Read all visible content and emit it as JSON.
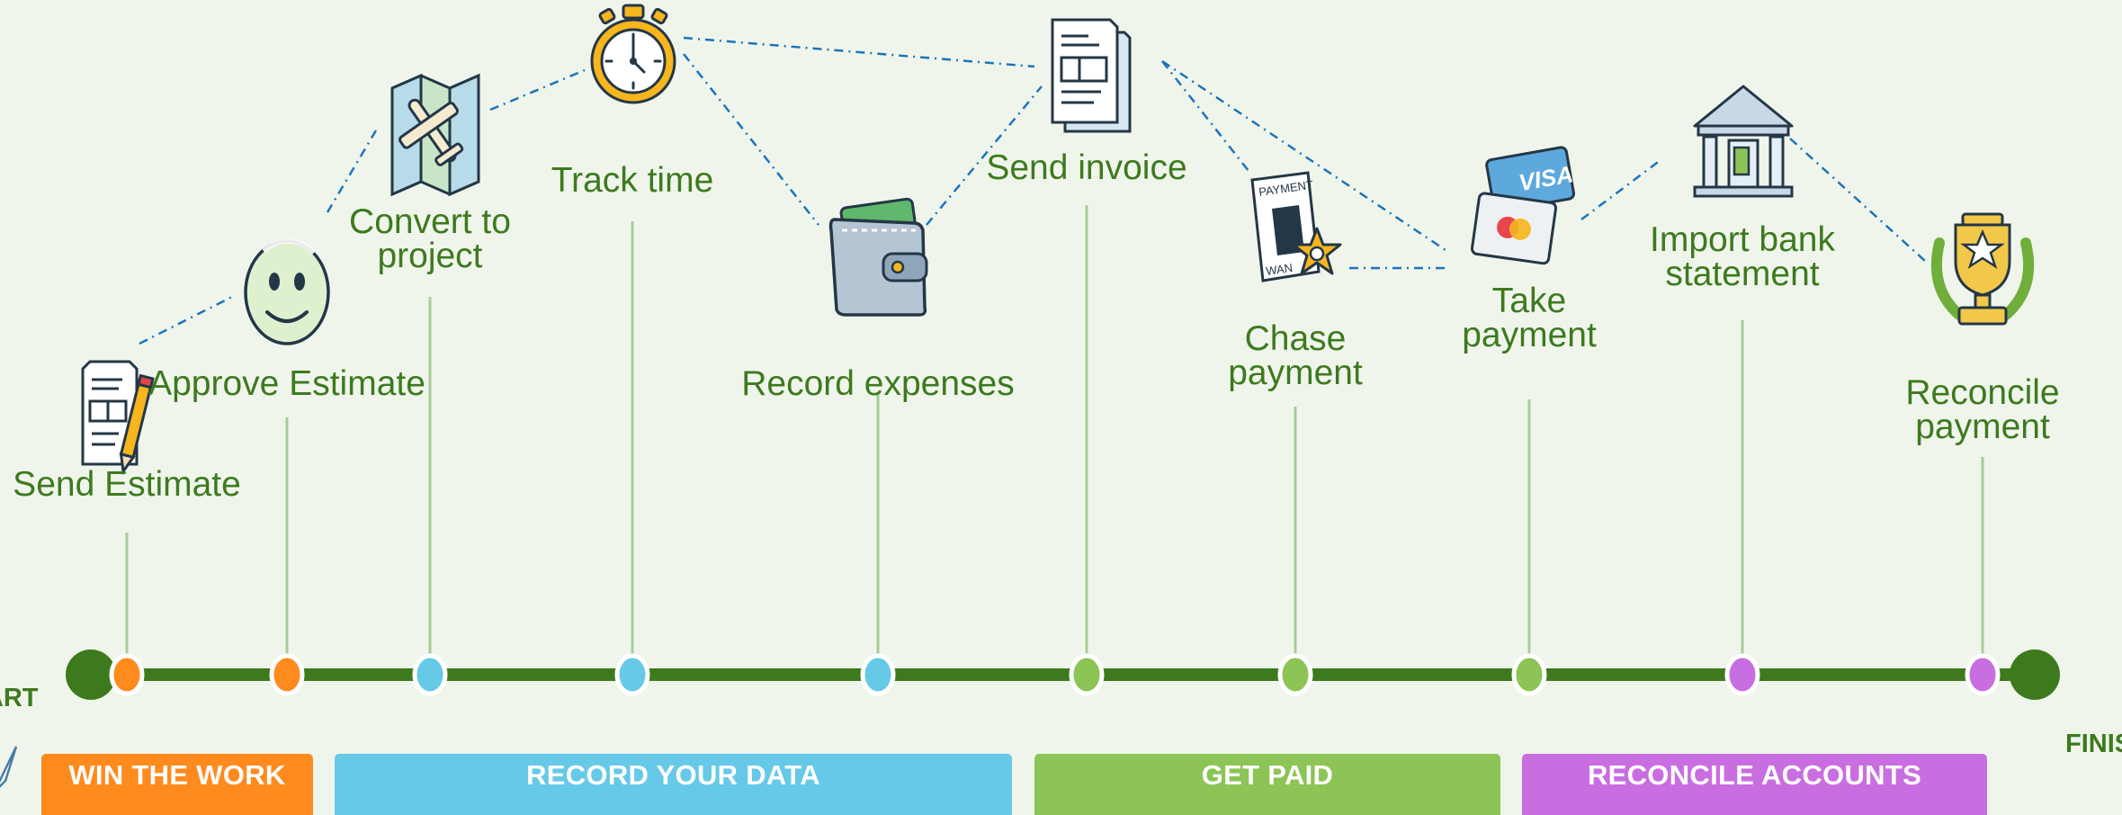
{
  "start_label": "START",
  "finish_label": "FINISH",
  "colors": {
    "track": "#3d7a1e",
    "win": "#ff8a1d",
    "record": "#66c9e8",
    "paid": "#8cc455",
    "reconcile": "#c96ee0",
    "dash": "#1b75bb",
    "label": "#3d7a1e"
  },
  "steps": [
    {
      "label": "Send Estimate",
      "phase": "win",
      "icon": "estimate-document-pencil-icon"
    },
    {
      "label": "Approve Estimate",
      "phase": "win",
      "icon": "smiley-face-icon"
    },
    {
      "label": "Convert to\nproject",
      "phase": "record",
      "icon": "map-airplane-icon"
    },
    {
      "label": "Track time",
      "phase": "record",
      "icon": "stopwatch-icon"
    },
    {
      "label": "Record expenses",
      "phase": "record",
      "icon": "wallet-icon"
    },
    {
      "label": "Send invoice",
      "phase": "paid",
      "icon": "invoice-document-icon"
    },
    {
      "label": "Chase\npayment",
      "phase": "paid",
      "icon": "payment-wanted-poster-icon"
    },
    {
      "label": "Take\npayment",
      "phase": "paid",
      "icon": "credit-cards-icon"
    },
    {
      "label": "Import bank\nstatement",
      "phase": "reconcile",
      "icon": "bank-building-icon"
    },
    {
      "label": "Reconcile\npayment",
      "phase": "reconcile",
      "icon": "trophy-icon"
    }
  ],
  "phases": [
    {
      "label": "WIN THE WORK",
      "key": "win"
    },
    {
      "label": "RECORD YOUR DATA",
      "key": "record"
    },
    {
      "label": "GET PAID",
      "key": "paid"
    },
    {
      "label": "RECONCILE ACCOUNTS",
      "key": "reconcile"
    }
  ]
}
